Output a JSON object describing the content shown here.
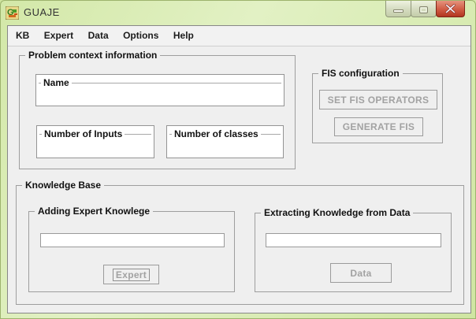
{
  "window": {
    "title": "GUAJE"
  },
  "menu": {
    "items": [
      "KB",
      "Expert",
      "Data",
      "Options",
      "Help"
    ]
  },
  "problem_context": {
    "title": "Problem context information",
    "name": {
      "label": "Name",
      "value": ""
    },
    "inputs": {
      "label": "Number of Inputs",
      "value": ""
    },
    "classes": {
      "label": "Number of classes",
      "value": ""
    }
  },
  "fis": {
    "title": "FIS configuration",
    "set_operators_label": "SET FIS OPERATORS",
    "generate_label": "GENERATE FIS"
  },
  "knowledge_base": {
    "title": "Knowledge Base",
    "expert": {
      "title": "Adding Expert Knowlege",
      "field_value": "",
      "button_label": "Expert"
    },
    "data": {
      "title": "Extracting Knowledge from Data",
      "field_value": "",
      "button_label": "Data"
    }
  },
  "colors": {
    "frame_green": "#d7ebb5",
    "client_bg": "#efefef",
    "close_red": "#c24534",
    "disabled_text": "#a2a2a2",
    "title_text": "#111111"
  }
}
